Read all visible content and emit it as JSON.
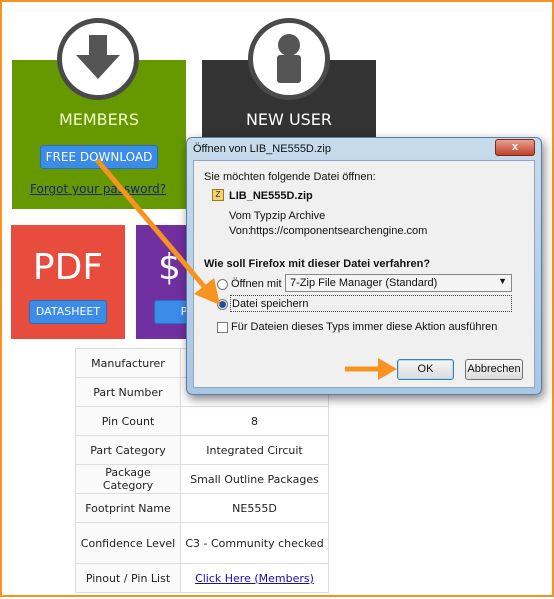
{
  "tiles": {
    "members": {
      "title": "MEMBERS",
      "button": "FREE DOWNLOAD",
      "link": "Forgot your password?"
    },
    "new_user": {
      "title": "NEW USER"
    },
    "pdf": {
      "title": "PDF",
      "button": "DATASHEET"
    },
    "price": {
      "title": "$",
      "button": "P"
    }
  },
  "table": [
    {
      "label": "Manufacturer",
      "value": ""
    },
    {
      "label": "Part Number",
      "value": ""
    },
    {
      "label": "Pin Count",
      "value": "8"
    },
    {
      "label": "Part Category",
      "value": "Integrated Circuit"
    },
    {
      "label": "Package Category",
      "value": "Small Outline Packages"
    },
    {
      "label": "Footprint Name",
      "value": "NE555D"
    },
    {
      "label": "Confidence Level",
      "value": "C3 - Community checked"
    },
    {
      "label": "Pinout / Pin List",
      "value": "Click Here (Members)"
    }
  ],
  "dialog": {
    "title": "Öffnen von LIB_NE555D.zip",
    "close": "x",
    "intro": "Sie möchten folgende Datei öffnen:",
    "filename": "LIB_NE555D.zip",
    "type_label": "Vom Typ:",
    "type_value": "zip Archive",
    "from_label": "Von:",
    "from_value": "https://componentsearchengine.com",
    "question": "Wie soll Firefox mit dieser Datei verfahren?",
    "open_with": "Öffnen mit",
    "open_with_app": "7-Zip File Manager (Standard)",
    "save_file": "Datei speichern",
    "always": "Für Dateien dieses Typs immer diese Aktion ausführen",
    "ok": "OK",
    "cancel": "Abbrechen",
    "selected": "save_file"
  },
  "colors": {
    "members": "#669900",
    "new_user": "#333333",
    "pdf": "#e74c3c",
    "price": "#7030a0",
    "annotation": "#f7931e",
    "button": "#3b8be8"
  }
}
